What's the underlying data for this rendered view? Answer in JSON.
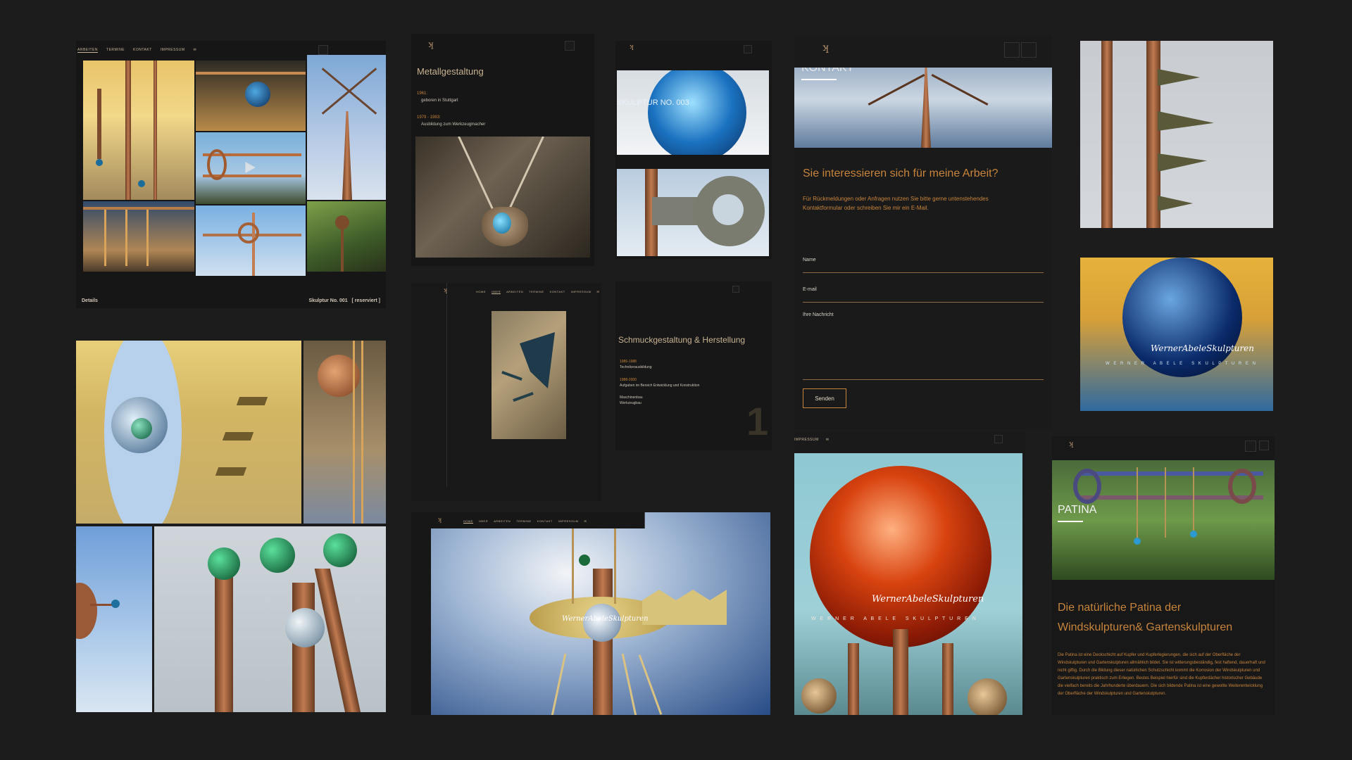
{
  "panel1": {
    "nav": [
      "ARBEITEN",
      "TERMINE",
      "KONTAKT",
      "IMPRESSUM",
      "✉"
    ],
    "details_label": "Details",
    "sculpture_title": "Skulptur No. 001",
    "sculpture_status": "[ reserviert ]"
  },
  "panel2": {
    "heading": "Metallgestaltung",
    "timeline": [
      {
        "year": "1961:",
        "text": "geboren in Stuttgart"
      },
      {
        "year": "1979 - 1983:",
        "text": "Ausbildung zum Werkzeugmacher"
      }
    ]
  },
  "panel3": {
    "nav": [
      "HOME",
      "ÜBER",
      "ARBEITEN",
      "TERMINE",
      "KONTAKT",
      "IMPRESSUM",
      "✉"
    ]
  },
  "panel4": {
    "caption": "SKULPTUR NO. 003"
  },
  "panel5": {
    "heading": "Schmuckgestaltung & Herstellung",
    "items": [
      {
        "year": "1986-1988",
        "text": "Technikerausbildung"
      },
      {
        "year": "1988-2000",
        "text": "Aufgaben im Bereich Entwicklung und Konstruktion"
      },
      {
        "year": "",
        "text": "Maschinenbau"
      },
      {
        "year": "",
        "text": "Werkzeugbau"
      }
    ],
    "big_number": "1"
  },
  "panel6": {
    "nav": [
      "HOME",
      "ÜBER",
      "ARBEITEN",
      "TERMINE",
      "KONTAKT",
      "IMPRESSUM",
      "✉"
    ],
    "logo_text": "WernerAbeleSkulpturen"
  },
  "contact": {
    "section_title": "KONTAKT",
    "heading": "Sie interessieren sich für meine Arbeit?",
    "intro": "Für Rückmeldungen oder Anfragen nutzen Sie bitte gerne untenstehendes Kontaktformular oder schreiben Sie mir ein E-Mail.",
    "name_label": "Name",
    "email_label": "E-mail",
    "message_label": "Ihre Nachricht",
    "submit": "Senden"
  },
  "panel8": {
    "nav": [
      "IMPRESSUM",
      "✉"
    ],
    "signature": "WernerAbeleSkulpturen",
    "brand": "W E R N E R   A B E L E   S K U L P T U R E N"
  },
  "panel9": {
    "signature": "WernerAbeleSkulpturen",
    "brand": "W E R N E R   A B E L E   S K U L P T U R E N"
  },
  "patina": {
    "overlay_title": "PATINA",
    "heading": "Die natürliche Patina der Windskulpturen& Gartenskulpturen",
    "body": "Die Patina ist eine Deckschicht auf Kupfer und Kupferlegierungen, die sich auf der Oberfläche der Windskulpturen und Gartenskulpturen allmählich bildet. Sie ist witterungsbeständig, fest haftend, dauerhaft und nicht giftig. Durch die Bildung dieser natürlichen Schutzschicht kommt die Korrosion der Windskulpturen und Gartenskulpturen praktisch zum Erliegen. Bestes Beispiel hierfür sind die Kupferdächer historischer Gebäude die vielfach bereits die Jahrhunderte überdauern. Die sich bildende Patina ist eine gewollte Weiterentwicklung der Oberfläche der Windskulpturen und Gartenskulpturen."
  },
  "colors": {
    "background": "#1c1c1c",
    "accent": "#c7843c",
    "text": "#c9c2b6"
  },
  "icons": [
    "logo-icon",
    "menu-icon",
    "search-icon",
    "play-icon",
    "mail-icon"
  ]
}
